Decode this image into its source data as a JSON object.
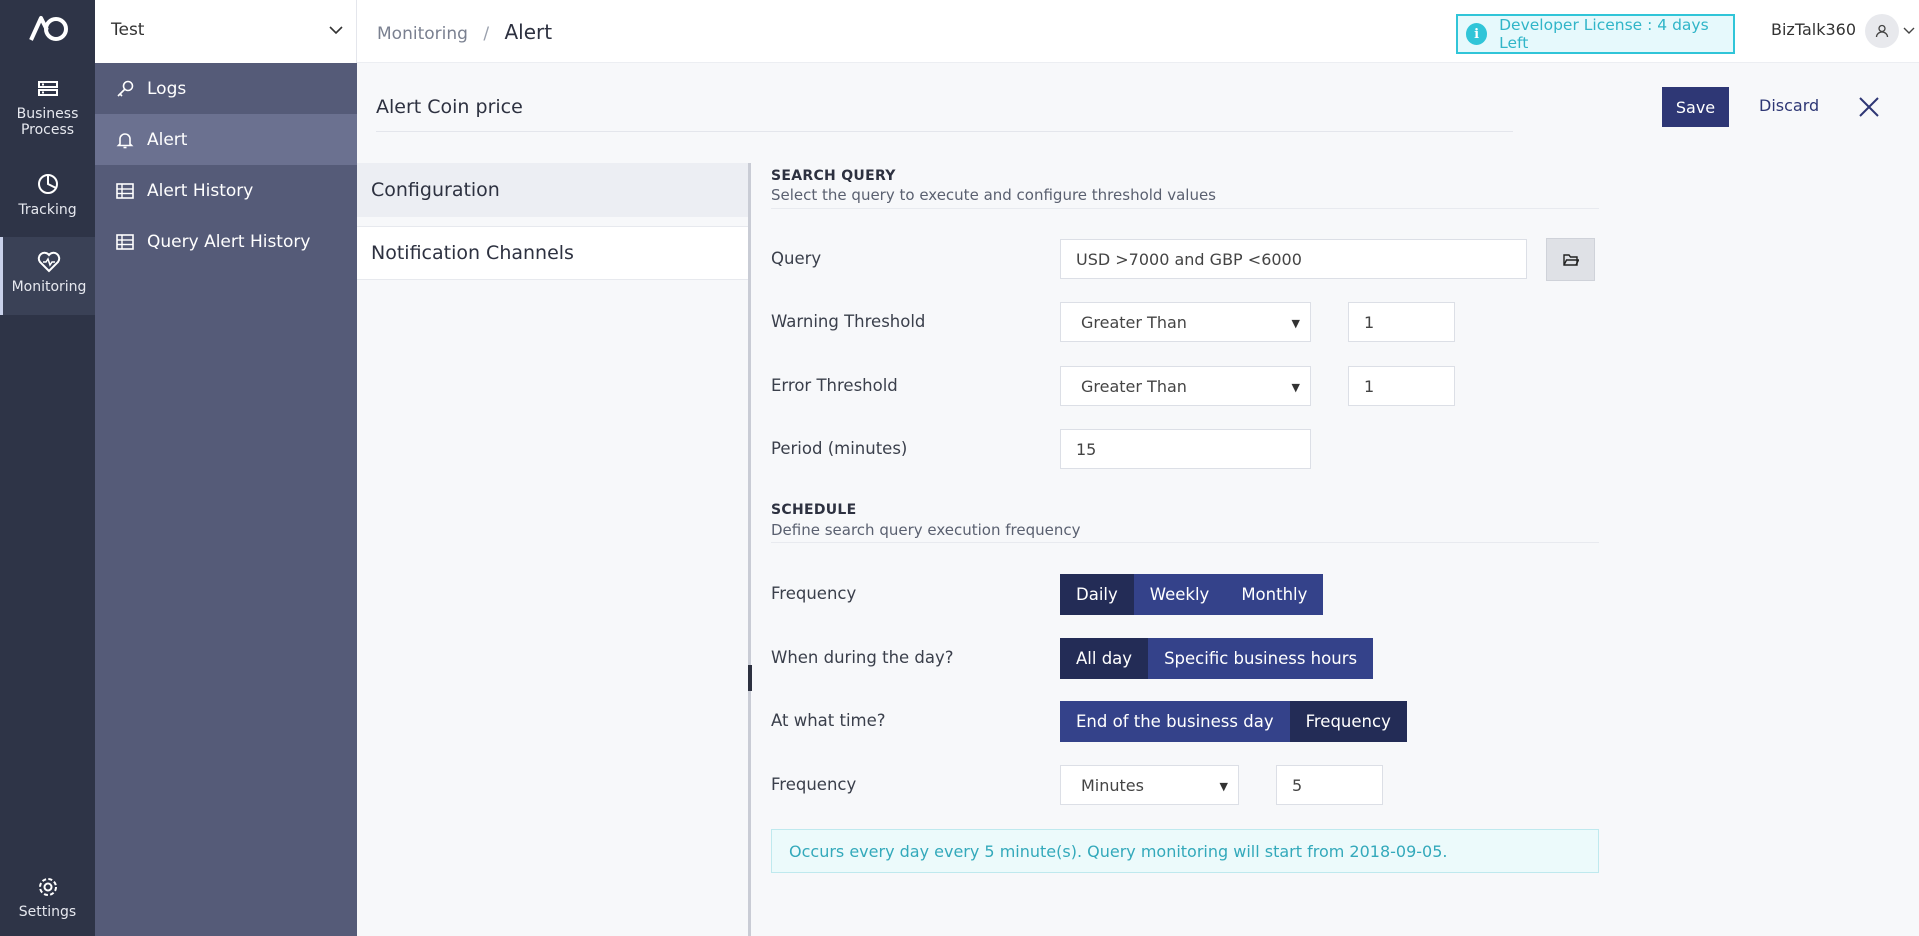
{
  "rail": {
    "items": [
      {
        "label_line1": "Business",
        "label_line2": "Process",
        "icon": "business-process-icon"
      },
      {
        "label": "Tracking",
        "icon": "tracking-icon"
      },
      {
        "label": "Monitoring",
        "icon": "monitoring-icon"
      },
      {
        "label": "Settings",
        "icon": "gear-icon"
      }
    ]
  },
  "environment": {
    "selected": "Test"
  },
  "subnav": {
    "items": [
      {
        "label": "Logs",
        "icon": "key-icon"
      },
      {
        "label": "Alert",
        "icon": "bell-icon"
      },
      {
        "label": "Alert History",
        "icon": "table-icon"
      },
      {
        "label": "Query Alert History",
        "icon": "table-icon"
      }
    ]
  },
  "breadcrumb": {
    "parent": "Monitoring",
    "separator": "/",
    "current": "Alert"
  },
  "license": {
    "text": "Developer License : 4 days Left",
    "icon_glyph": "i"
  },
  "user": {
    "name": "BizTalk360"
  },
  "form": {
    "title": "Alert Coin price",
    "save_label": "Save",
    "discard_label": "Discard"
  },
  "tabs": [
    {
      "label": "Configuration"
    },
    {
      "label": "Notification Channels"
    }
  ],
  "search_query": {
    "title": "SEARCH QUERY",
    "subtitle": "Select the query to execute and configure threshold values",
    "query_label": "Query",
    "query_value": "USD >7000 and GBP <6000",
    "warning_label": "Warning Threshold",
    "warning_operator": "Greater Than",
    "warning_value": "1",
    "error_label": "Error Threshold",
    "error_operator": "Greater Than",
    "error_value": "1",
    "period_label": "Period (minutes)",
    "period_value": "15"
  },
  "schedule": {
    "title": "SCHEDULE",
    "subtitle": "Define search query execution frequency",
    "frequency_label": "Frequency",
    "frequency_options": [
      "Daily",
      "Weekly",
      "Monthly"
    ],
    "during_label": "When during the day?",
    "during_options": [
      "All day",
      "Specific business hours"
    ],
    "time_label": "At what time?",
    "time_options": [
      "End of the business day",
      "Frequency"
    ],
    "freq_unit_label": "Frequency",
    "freq_unit": "Minutes",
    "freq_value": "5",
    "summary": "Occurs every day every 5 minute(s). Query monitoring will start from 2018-09-05."
  },
  "colors": {
    "rail_bg": "#2e3447",
    "subnav_bg": "#555b78",
    "primary": "#2e3775",
    "segment_selected": "#232c56",
    "info": "#30c5d8"
  }
}
